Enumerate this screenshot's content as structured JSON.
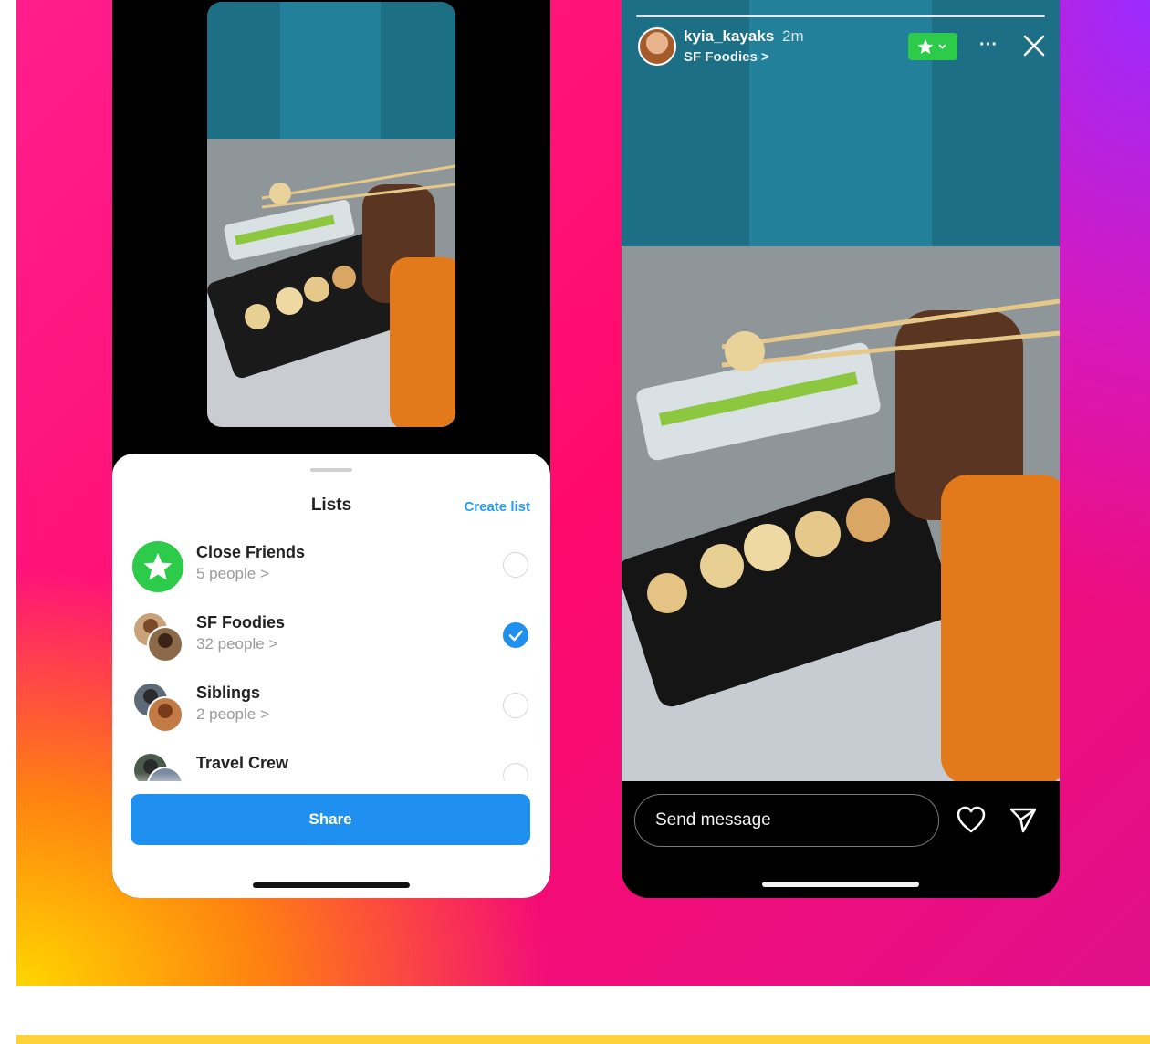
{
  "sheet": {
    "title": "Lists",
    "create_list": "Create list",
    "items": [
      {
        "name": "Close Friends",
        "sub": "5 people",
        "chevron": ">",
        "selected": false,
        "avatar": "star-icon"
      },
      {
        "name": "SF Foodies",
        "sub": "32 people",
        "chevron": ">",
        "selected": true,
        "avatar": "group-avatar"
      },
      {
        "name": "Siblings",
        "sub": "2 people",
        "chevron": ">",
        "selected": false,
        "avatar": "group-avatar"
      },
      {
        "name": "Travel Crew",
        "sub": "",
        "chevron": "",
        "selected": false,
        "avatar": "group-avatar"
      }
    ],
    "share_label": "Share"
  },
  "story": {
    "username": "kyia_kayaks",
    "time": "2m",
    "list_name": "SF Foodies",
    "chevron": ">",
    "more": "···",
    "message_placeholder": "Send message"
  },
  "colors": {
    "accent_blue": "#1f8ff0",
    "link_blue": "#2a9df4",
    "close_friends_green": "#2dcb4a",
    "gradient_yellow": "#ffd600",
    "gradient_pink": "#ff1e8c",
    "gradient_purple": "#9b2bff"
  }
}
